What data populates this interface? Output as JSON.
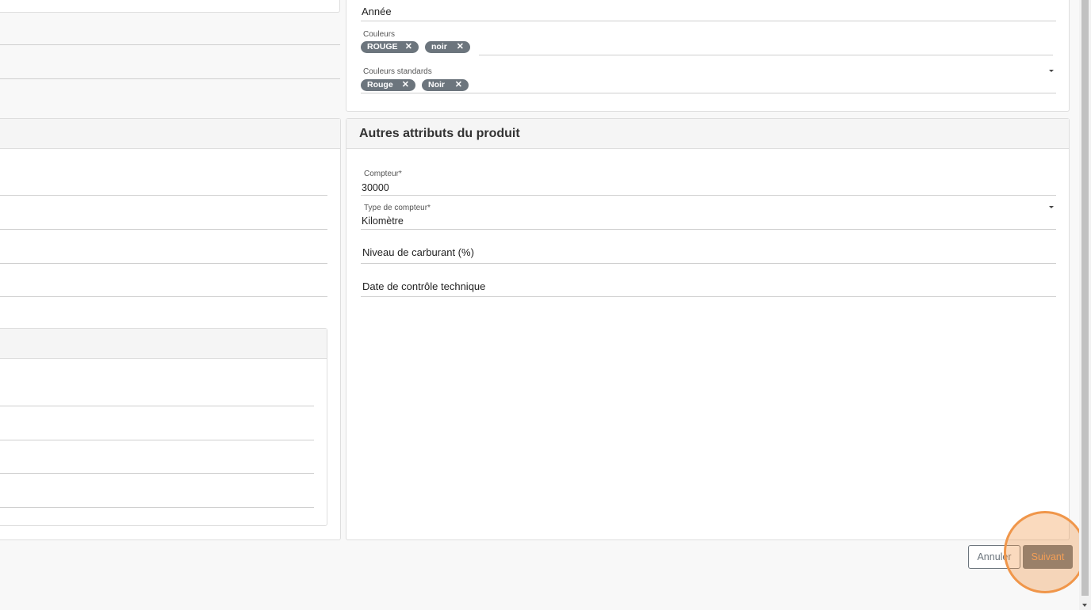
{
  "right_top": {
    "annee_label": "Année",
    "couleurs": {
      "label": "Couleurs",
      "chips": [
        "ROUGE",
        "noir"
      ]
    },
    "couleurs_standards": {
      "label": "Couleurs standards",
      "chips": [
        "Rouge",
        "Noir"
      ]
    }
  },
  "autres": {
    "title": "Autres attributs du produit",
    "compteur_label": "Compteur*",
    "compteur_value": "30000",
    "type_compteur_label": "Type de compteur*",
    "type_compteur_value": "Kilomètre",
    "niveau_label": "Niveau de carburant (%)",
    "date_label": "Date de contrôle technique"
  },
  "actions": {
    "annuler": "Annuler",
    "suivant": "Suivant"
  },
  "chip_remove_glyph": "✕",
  "colors": {
    "chip_bg": "#6c757d",
    "highlight": "#f0964a",
    "suivant_text": "#f4a460"
  }
}
